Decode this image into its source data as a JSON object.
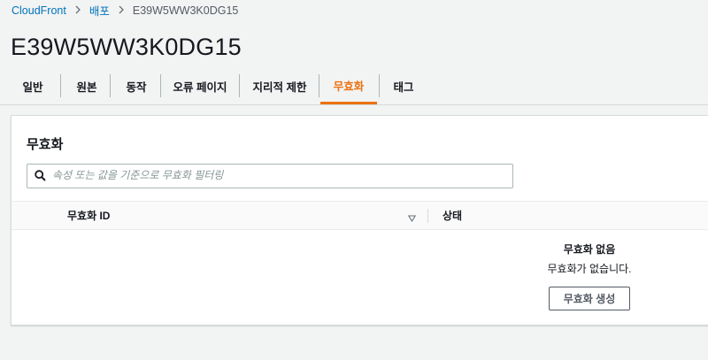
{
  "breadcrumb": {
    "items": [
      "CloudFront",
      "배포"
    ],
    "current": "E39W5WW3K0DG15"
  },
  "page_title": "E39W5WW3K0DG15",
  "tabs": [
    {
      "label": "일반",
      "active": false
    },
    {
      "label": "원본",
      "active": false
    },
    {
      "label": "동작",
      "active": false
    },
    {
      "label": "오류 페이지",
      "active": false
    },
    {
      "label": "지리적 제한",
      "active": false
    },
    {
      "label": "무효화",
      "active": true
    },
    {
      "label": "태그",
      "active": false
    }
  ],
  "panel": {
    "title": "무효화",
    "search_placeholder": "속성 또는 값을 기준으로 무효화 필터링",
    "columns": [
      "무효화 ID",
      "상태"
    ],
    "empty_title": "무효화 없음",
    "empty_desc": "무효화가 없습니다.",
    "create_button": "무효화 생성"
  },
  "colors": {
    "accent": "#ec7211",
    "link": "#0073bb"
  },
  "icons": [
    "search-icon",
    "chevron-right-icon",
    "sort-caret-icon"
  ]
}
